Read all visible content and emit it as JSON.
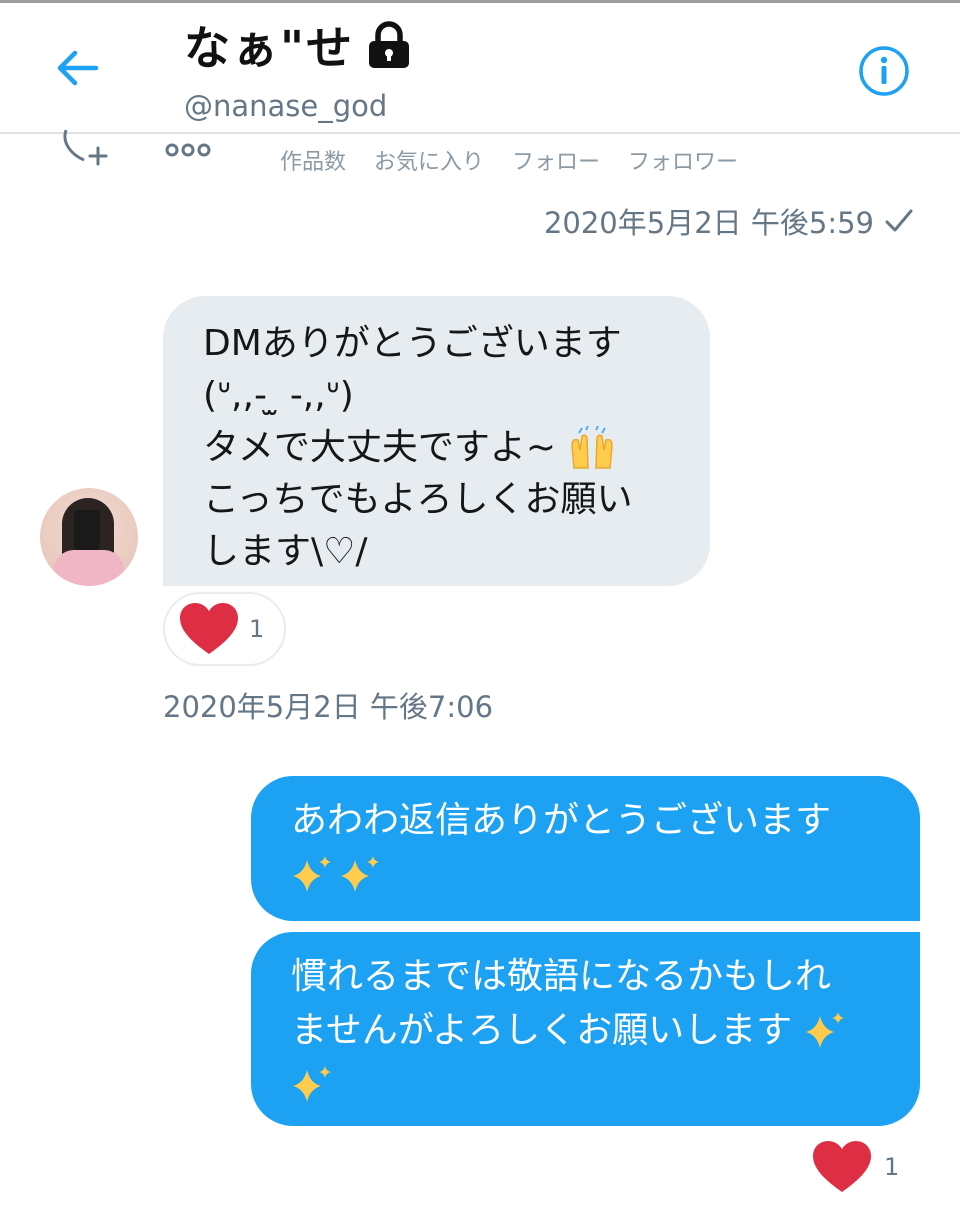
{
  "header": {
    "title": "なぁ\"せ",
    "handle": "@nanase_god",
    "lock_icon": "lock-icon",
    "back_icon": "arrow-left-icon",
    "info_icon": "info-icon",
    "accent": "#1da1f2"
  },
  "profile_strip": {
    "stats": [
      "作品数",
      "お気に入り",
      "フォロー",
      "フォロワー"
    ]
  },
  "messages": {
    "timestamp_sent": "2020年5月2日 午後5:59",
    "received": {
      "lines": [
        "DMありがとうございます",
        "(ᐡ,,- ̫ -,,ᐡ)",
        "タメで大丈夫ですよ~",
        "こっちでもよろしくお願い",
        "します\\♡/"
      ],
      "reaction_count": "1"
    },
    "timestamp_received": "2020年5月2日 午後7:06",
    "sent": [
      {
        "lines": [
          "あわわ返信ありがとうございます",
          ""
        ]
      },
      {
        "lines": [
          "慣れるまでは敬語になるかもしれ",
          "ませんがよろしくお願いします",
          ""
        ]
      }
    ],
    "sent_reaction_count": "1"
  },
  "colors": {
    "bubble_in": "#e6ecf0",
    "bubble_out": "#1da1f2",
    "heart": "#e0245e",
    "muted_text": "#657786"
  }
}
